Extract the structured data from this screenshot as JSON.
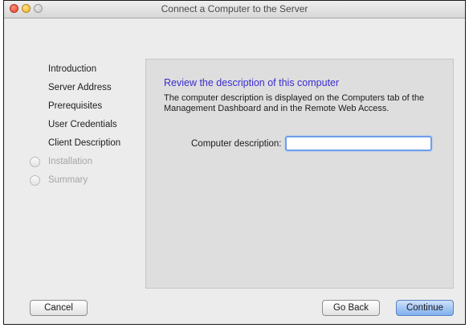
{
  "window": {
    "title": "Connect a Computer to the Server"
  },
  "steps": [
    {
      "label": "Introduction",
      "state": "done"
    },
    {
      "label": "Server Address",
      "state": "done"
    },
    {
      "label": "Prerequisites",
      "state": "done"
    },
    {
      "label": "User Credentials",
      "state": "done"
    },
    {
      "label": "Client Description",
      "state": "current"
    },
    {
      "label": "Installation",
      "state": "pending"
    },
    {
      "label": "Summary",
      "state": "pending"
    }
  ],
  "panel": {
    "heading": "Review the description of this computer",
    "description": "The computer description is displayed on the Computers tab of the Management Dashboard and in the Remote Web Access.",
    "field_label": "Computer description:",
    "field_value": ""
  },
  "buttons": {
    "cancel": "Cancel",
    "go_back": "Go Back",
    "continue": "Continue"
  },
  "colors": {
    "heading": "#3b2ccf",
    "focus_ring": "#6f9ee9",
    "default_button": "#7fb0ee"
  }
}
